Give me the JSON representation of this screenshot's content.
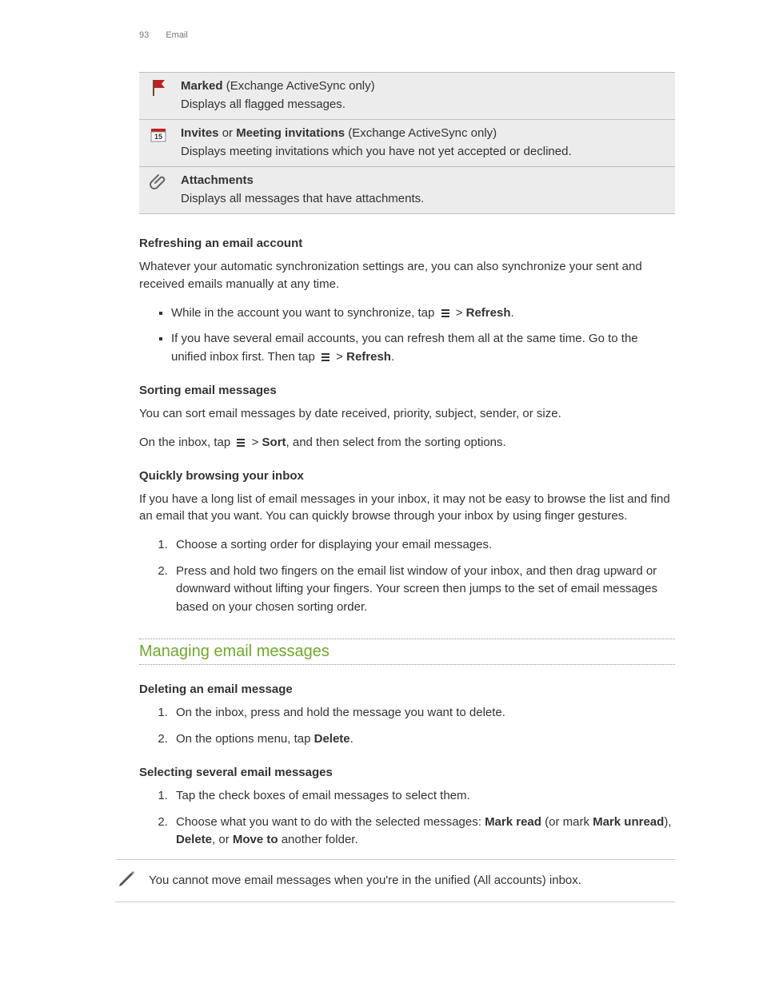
{
  "header": {
    "page_num": "93",
    "section": "Email"
  },
  "table": {
    "rows": [
      {
        "title_pre": "Marked",
        "title_rest": " (Exchange ActiveSync only)",
        "desc": "Displays all flagged messages."
      },
      {
        "title_pre": "Invites",
        "mid": " or ",
        "title_bold2": "Meeting invitations",
        "title_rest": " (Exchange ActiveSync only)",
        "desc": "Displays meeting invitations which you have not yet accepted or declined."
      },
      {
        "title_pre": "Attachments",
        "title_rest": "",
        "desc": "Displays all messages that have attachments."
      }
    ]
  },
  "s1": {
    "heading": "Refreshing an email account",
    "para": "Whatever your automatic synchronization settings are, you can also synchronize your sent and received emails manually at any time.",
    "bullet1_pre": "While in the account you want to synchronize, tap ",
    "bullet1_post": " > ",
    "bullet1_bold": "Refresh",
    "bullet1_end": ".",
    "bullet2a": "If you have several email accounts, you can refresh them all at the same time. Go to the unified inbox first. Then tap ",
    "bullet2b": " > ",
    "bullet2_bold": "Refresh",
    "bullet2c": "."
  },
  "s2": {
    "heading": "Sorting email messages",
    "para1": "You can sort email messages by date received, priority, subject, sender, or size.",
    "para2_pre": "On the inbox, tap ",
    "para2_mid": " > ",
    "para2_bold": "Sort",
    "para2_post": ", and then select from the sorting options."
  },
  "s3": {
    "heading": "Quickly browsing your inbox",
    "para": "If you have a long list of email messages in your inbox, it may not be easy to browse the list and find an email that you want. You can quickly browse through your inbox by using finger gestures.",
    "step1": "Choose a sorting order for displaying your email messages.",
    "step2": "Press and hold two fingers on the email list window of your inbox, and then drag upward or downward without lifting your fingers. Your screen then jumps to the set of email messages based on your chosen sorting order."
  },
  "green_heading": "Managing email messages",
  "s4": {
    "heading": "Deleting an email message",
    "step1": "On the inbox, press and hold the message you want to delete.",
    "step2_pre": "On the options menu, tap ",
    "step2_bold": "Delete",
    "step2_post": "."
  },
  "s5": {
    "heading": "Selecting several email messages",
    "step1": "Tap the check boxes of email messages to select them.",
    "step2_pre": "Choose what you want to do with the selected messages: ",
    "step2_b1": "Mark read",
    "step2_mid1": " (or mark ",
    "step2_b2": "Mark unread",
    "step2_mid2": "), ",
    "step2_b3": "Delete",
    "step2_mid3": ", or ",
    "step2_b4": "Move to",
    "step2_post": " another folder."
  },
  "note": "You cannot move email messages when you're in the unified (All accounts) inbox."
}
